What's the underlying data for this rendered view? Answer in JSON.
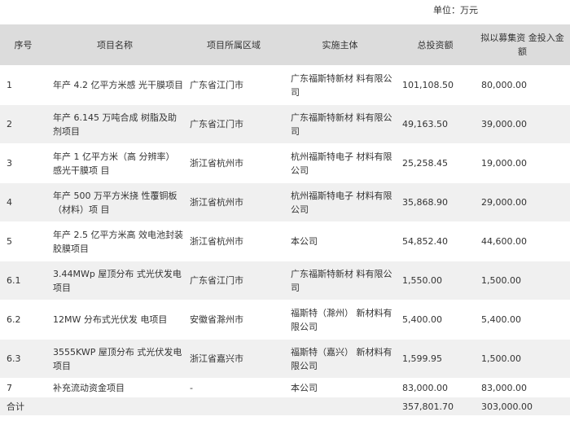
{
  "unit_label": "单位：万元",
  "headers": [
    "序号",
    "项目名称",
    "项目所属区域",
    "实施主体",
    "总投资额",
    "拟以募集资 金投入金 额"
  ],
  "rows": [
    {
      "no": "1",
      "name": "年产 4.2 亿平方米感 光干膜项目",
      "region": "广东省江门市",
      "entity": "广东福斯特新材 料有限公司",
      "total": "101,108.50",
      "raised": "80,000.00"
    },
    {
      "no": "2",
      "name": "年产 6.145 万吨合成 树脂及助剂项目",
      "region": "广东省江门市",
      "entity": "广东福斯特新材 料有限公司",
      "total": "49,163.50",
      "raised": "39,000.00"
    },
    {
      "no": "3",
      "name": "年产 1 亿平方米（高 分辨率）感光干膜项 目",
      "region": "浙江省杭州市",
      "entity": "杭州福斯特电子 材料有限公司",
      "total": "25,258.45",
      "raised": "19,000.00"
    },
    {
      "no": "4",
      "name": "年产 500 万平方米挠 性覆铜板（材料）项 目",
      "region": "浙江省杭州市",
      "entity": "杭州福斯特电子 材料有限公司",
      "total": "35,868.90",
      "raised": "29,000.00"
    },
    {
      "no": "5",
      "name": "年产 2.5 亿平方米高 效电池封装胶膜项目",
      "region": "浙江省杭州市",
      "entity": "本公司",
      "total": "54,852.40",
      "raised": "44,600.00"
    },
    {
      "no": "6.1",
      "name": "3.44MWp 屋顶分布 式光伏发电项目",
      "region": "广东省江门市",
      "entity": "广东福斯特新材 料有限公司",
      "total": "1,550.00",
      "raised": "1,500.00"
    },
    {
      "no": "6.2",
      "name": "12MW 分布式光伏发 电项目",
      "region": "安徽省滁州市",
      "entity": "福斯特（滁州） 新材料有限公司",
      "total": "5,400.00",
      "raised": "5,400.00"
    },
    {
      "no": "6.3",
      "name": "3555KWP 屋顶分布 式光伏发电项目",
      "region": "浙江省嘉兴市",
      "entity": "福斯特（嘉兴） 新材料有限公司",
      "total": "1,599.95",
      "raised": "1,500.00"
    },
    {
      "no": "7",
      "name": "补充流动资金项目",
      "region": "-",
      "entity": "本公司",
      "total": "83,000.00",
      "raised": "83,000.00"
    }
  ],
  "total_row": {
    "label": "合计",
    "total": "357,801.70",
    "raised": "303,000.00"
  }
}
